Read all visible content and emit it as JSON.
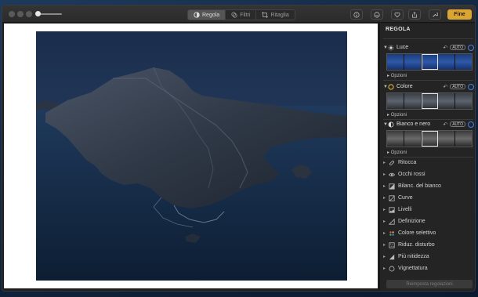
{
  "toolbar": {
    "tabs": [
      {
        "label": "Regola",
        "icon": "adjust-icon",
        "active": true
      },
      {
        "label": "Filtri",
        "icon": "filters-icon",
        "active": false
      },
      {
        "label": "Ritaglia",
        "icon": "crop-icon",
        "active": false
      }
    ],
    "right_icons": [
      "info-icon",
      "enhance-icon",
      "heart-icon",
      "share-icon",
      "tools-icon"
    ],
    "done_label": "Fine",
    "done_color": "#d9a534"
  },
  "sidebar": {
    "title": "REGOLA",
    "adjustments": [
      {
        "label": "Luce",
        "icon": "sun-icon",
        "auto": "AUTO",
        "options_label": "Opzioni",
        "strip": "blue"
      },
      {
        "label": "Colore",
        "icon": "color-circle-icon",
        "auto": "AUTO",
        "options_label": "Opzioni",
        "strip": "gray"
      },
      {
        "label": "Bianco e nero",
        "icon": "half-circle-icon",
        "auto": "AUTO",
        "options_label": "Opzioni",
        "strip": "bw"
      }
    ],
    "tools": [
      {
        "label": "Ritocca",
        "icon": "bandage-icon"
      },
      {
        "label": "Occhi rossi",
        "icon": "eye-icon"
      },
      {
        "label": "Bilanc. del bianco",
        "icon": "white-balance-icon"
      },
      {
        "label": "Curve",
        "icon": "curves-icon"
      },
      {
        "label": "Livelli",
        "icon": "levels-icon"
      },
      {
        "label": "Definizione",
        "icon": "definition-icon"
      },
      {
        "label": "Colore selettivo",
        "icon": "selective-color-icon"
      },
      {
        "label": "Riduz. disturbo",
        "icon": "noise-icon"
      },
      {
        "label": "Più nitidezza",
        "icon": "sharpen-icon"
      },
      {
        "label": "Vignettatura",
        "icon": "vignette-icon"
      }
    ],
    "reset_label": "Reimposta regolazioni"
  },
  "colors": {
    "accent": "#3b82f6",
    "window_bg": "#1e1e1e",
    "sidebar_bg": "#242424"
  }
}
